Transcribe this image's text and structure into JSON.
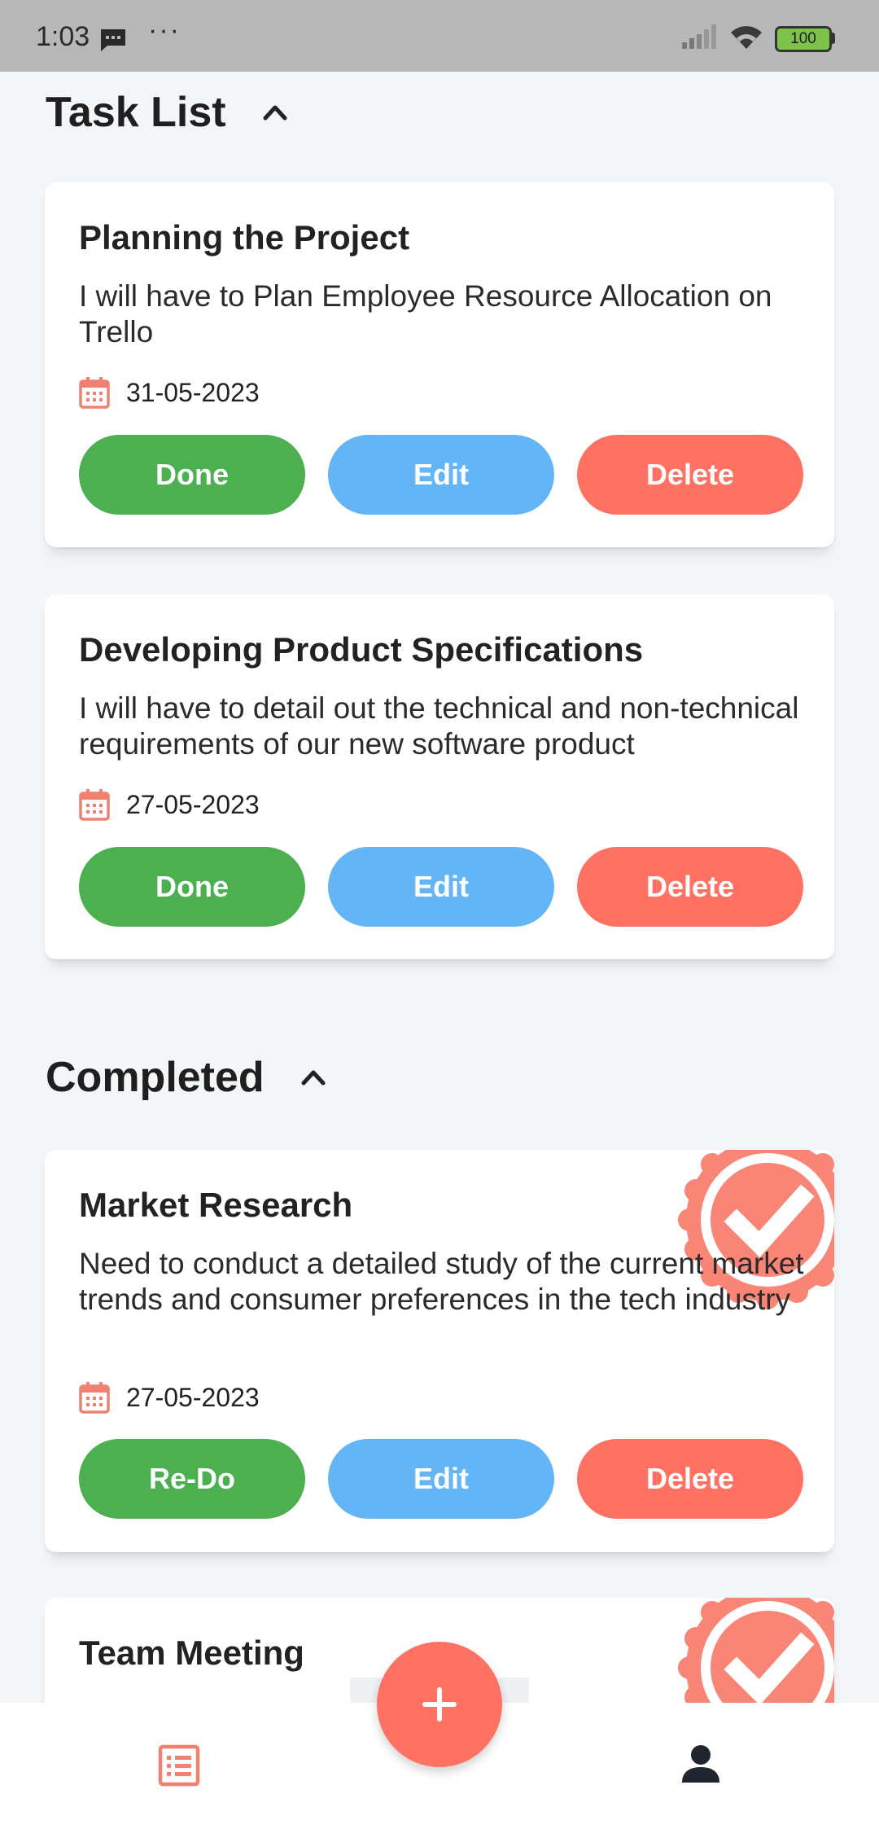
{
  "status_bar": {
    "time": "1:03",
    "more": "···",
    "battery": "100"
  },
  "sections": {
    "task_list": {
      "title": "Task List"
    },
    "completed": {
      "title": "Completed"
    }
  },
  "tasks": [
    {
      "title": "Planning the Project",
      "description": "I will have to Plan Employee Resource Allocation on Trello",
      "date": "31-05-2023",
      "actions": {
        "primary": "Done",
        "edit": "Edit",
        "delete": "Delete"
      }
    },
    {
      "title": "Developing Product Specifications",
      "description": "I will have to detail out the technical and non-technical requirements of our new software product",
      "date": "27-05-2023",
      "actions": {
        "primary": "Done",
        "edit": "Edit",
        "delete": "Delete"
      }
    }
  ],
  "completed_tasks": [
    {
      "title": "Market Research",
      "description": "Need to conduct a detailed study of the current market trends and consumer preferences in the tech industry",
      "date": "27-05-2023",
      "actions": {
        "primary": "Re-Do",
        "edit": "Edit",
        "delete": "Delete"
      }
    },
    {
      "title": "Team Meeting"
    }
  ],
  "icons": {
    "calendar": "calendar-icon",
    "check_stamp": "check-badge-icon",
    "add": "plus-icon",
    "tasks_nav": "list-icon",
    "profile_nav": "person-icon"
  },
  "colors": {
    "done": "#4caf50",
    "edit": "#64b5f6",
    "delete": "#ff7263",
    "accent": "#ff7263"
  }
}
